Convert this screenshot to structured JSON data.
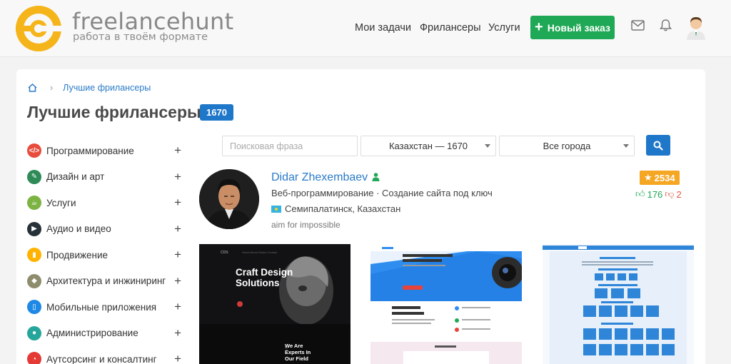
{
  "header": {
    "logo_name": "freelancehunt",
    "logo_tagline": "работа в твоём формате",
    "nav": [
      "Мои задачи",
      "Фрилансеры",
      "Услуги"
    ],
    "new_order_label": "Новый заказ"
  },
  "breadcrumb": {
    "current": "Лучшие фрилансеры"
  },
  "page": {
    "title": "Лучшие фрилансеры",
    "count": "1670"
  },
  "categories": [
    {
      "label": "Программирование",
      "color": "#e74c3c"
    },
    {
      "label": "Дизайн и арт",
      "color": "#2e8b57"
    },
    {
      "label": "Услуги",
      "color": "#7cb342"
    },
    {
      "label": "Аудио и видео",
      "color": "#263238"
    },
    {
      "label": "Продвижение",
      "color": "#ffb300"
    },
    {
      "label": "Архитектура и инжиниринг",
      "color": "#8d8d6e"
    },
    {
      "label": "Мобильные приложения",
      "color": "#1e88e5"
    },
    {
      "label": "Администрирование",
      "color": "#26a69a"
    },
    {
      "label": "Аутсорсинг и консалтинг",
      "color": "#e53935"
    }
  ],
  "filters": {
    "search_placeholder": "Поисковая фраза",
    "country": "Казахстан — 1670",
    "city": "Все города"
  },
  "freelancer": {
    "name": "Didar Zhexembaev",
    "skills": "Веб-программирование · Создание сайта под ключ",
    "location": "Семипалатинск, Казахстан",
    "motto": "aim for impossible",
    "rating": "2534",
    "positive": "176",
    "negative": "2"
  },
  "portfolio": {
    "p1_title": "Craft Design Solutions",
    "p1_sub": "We Are Experts In Our Field"
  },
  "colors": {
    "primary": "#1f77c9",
    "green": "#1fa855",
    "star": "#f5a623"
  }
}
